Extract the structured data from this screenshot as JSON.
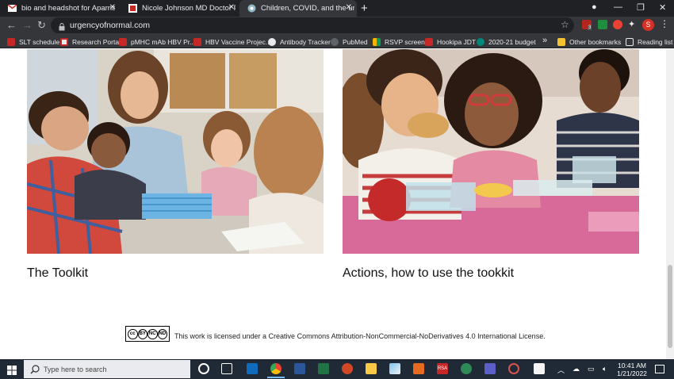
{
  "tabs": [
    {
      "title": "bio and headshot for Aparna - sl",
      "icon": "gmail-icon",
      "active": false
    },
    {
      "title": "Nicole Johnson MD Doctor Profi",
      "icon": "profile-page-icon",
      "active": false
    },
    {
      "title": "Children, COVID, and the urgenc",
      "icon": "site-globe-icon",
      "active": true
    }
  ],
  "address_bar": {
    "url": "urgencyofnormal.com"
  },
  "extension_badge": "3",
  "profile_initial": "S",
  "bookmarks": [
    {
      "label": "SLT schedule"
    },
    {
      "label": "Research Portal"
    },
    {
      "label": "pMHC mAb HBV Pr..."
    },
    {
      "label": "HBV Vaccine Projec..."
    },
    {
      "label": "Antibody Tracker"
    },
    {
      "label": "PubMed"
    },
    {
      "label": "RSVP screen"
    },
    {
      "label": "Hookipa JDT"
    },
    {
      "label": "2020-21 budget"
    }
  ],
  "bookmarks_overflow": "»",
  "other_bookmarks": "Other bookmarks",
  "reading_list": "Reading list",
  "cards": [
    {
      "title": "The Toolkit"
    },
    {
      "title": "Actions, how to use the tookkit"
    }
  ],
  "license": {
    "badge": [
      "cc",
      "BY",
      "NC",
      "ND"
    ],
    "text": "This work is licensed under a Creative Commons Attribution-NonCommercial-NoDerivatives 4.0 International License."
  },
  "taskbar": {
    "search_placeholder": "Type here to search",
    "time": "10:41 AM",
    "date": "1/21/2022"
  },
  "colors": {
    "chrome_dark": "#202124",
    "chrome_toolbar": "#35363a",
    "taskbar": "#1f2a36",
    "profile": "#d93025"
  }
}
